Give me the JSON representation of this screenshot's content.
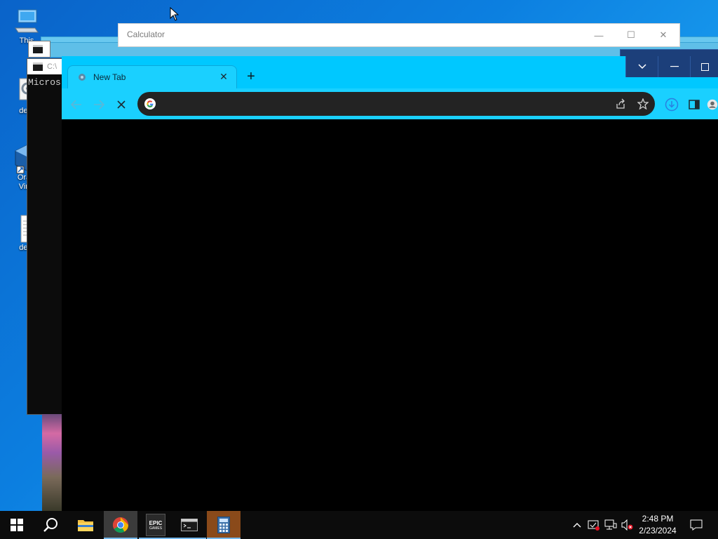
{
  "desktop": {
    "icons": [
      {
        "label": "This",
        "icon": "computer-icon"
      },
      {
        "label": "deat",
        "icon": "settings-file-icon"
      },
      {
        "label": "Oracl",
        "label2": "Virtu",
        "icon": "virtualbox-icon"
      },
      {
        "label": "deat",
        "icon": "text-file-icon"
      }
    ]
  },
  "calculator": {
    "title": "Calculator",
    "minimize": "—",
    "maximize": "☐",
    "close": "✕"
  },
  "console": {
    "title": "C:\\",
    "text": "Micros"
  },
  "chrome": {
    "tab": {
      "title": "New Tab",
      "close": "✕"
    },
    "new_tab": "+",
    "omnibox": {
      "value": "",
      "placeholder": ""
    },
    "controls": {
      "dropdown": "⌄",
      "minimize": "—",
      "maximize": "☐"
    }
  },
  "taskbar": {
    "apps": [
      "start",
      "search",
      "file-explorer",
      "chrome",
      "epic-games",
      "terminal",
      "calculator"
    ],
    "epic_label": "EPIC",
    "epic_sub": "GAMES",
    "clock": {
      "time": "2:48 PM",
      "date": "2/23/2024"
    }
  },
  "colors": {
    "chrome_accent": "#00c8ff",
    "taskbar": "#0c0c0c",
    "desktop": "#0c7fe0"
  }
}
